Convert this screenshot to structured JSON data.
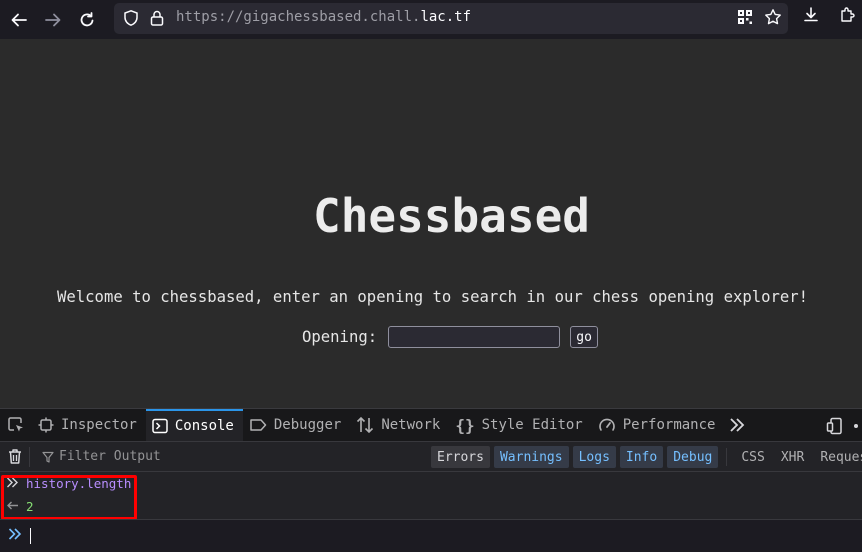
{
  "browser": {
    "url_prefix": "https://gigachessbased.chall.",
    "url_domain": "lac.tf"
  },
  "page": {
    "title": "Chessbased",
    "welcome_text": "Welcome to chessbased, enter an opening to search in our chess opening explorer!",
    "opening_label": "Opening:",
    "opening_value": "",
    "go_label": "go"
  },
  "devtools": {
    "tabs": [
      {
        "label": "Inspector",
        "icon": "inspector-icon"
      },
      {
        "label": "Console",
        "icon": "console-icon"
      },
      {
        "label": "Debugger",
        "icon": "debugger-icon"
      },
      {
        "label": "Network",
        "icon": "network-icon"
      },
      {
        "label": "Style Editor",
        "icon": "style-editor-icon"
      },
      {
        "label": "Performance",
        "icon": "performance-icon"
      }
    ],
    "filter_placeholder": "Filter Output",
    "filters": {
      "errors": "Errors",
      "warnings": "Warnings",
      "logs": "Logs",
      "info": "Info",
      "debug": "Debug",
      "css": "CSS",
      "xhr": "XHR",
      "requests": "Requests"
    },
    "console": {
      "input_expr": "history.length",
      "output_value": "2",
      "prompt": "»"
    }
  },
  "colors": {
    "accent_blue": "#2b95e9",
    "highlight_red": "#ff0000",
    "command_purple": "#b98eff",
    "result_green": "#86de74"
  }
}
